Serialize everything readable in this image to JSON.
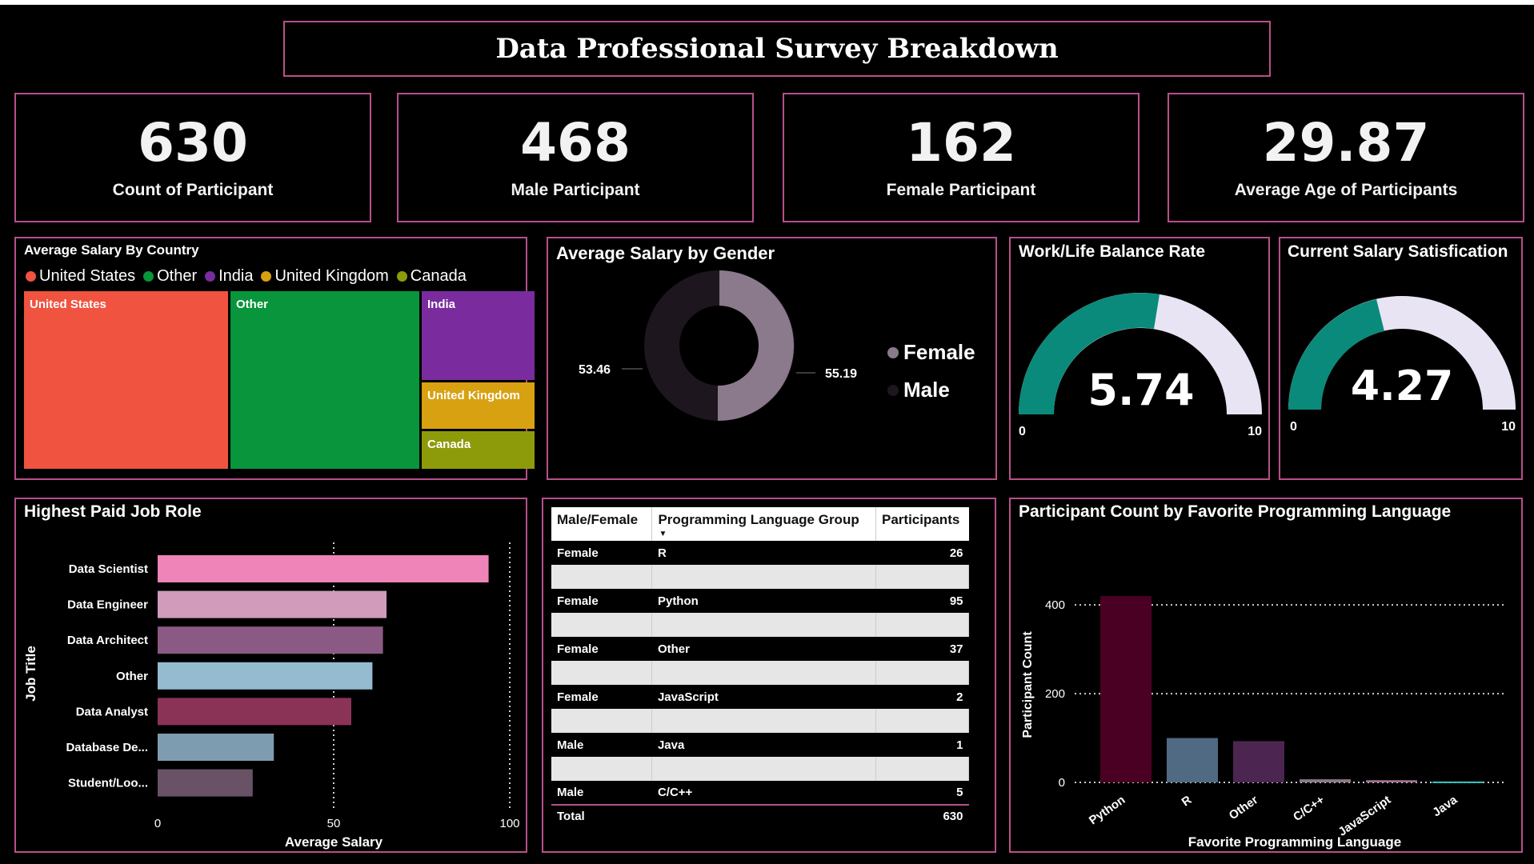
{
  "header": {
    "title": "Data Professional Survey Breakdown"
  },
  "kpis": [
    {
      "value": "630",
      "label": "Count of Participant"
    },
    {
      "value": "468",
      "label": "Male Participant"
    },
    {
      "value": "162",
      "label": "Female Participant"
    },
    {
      "value": "29.87",
      "label": "Average Age of Participants"
    }
  ],
  "treemap": {
    "title": "Average Salary By Country",
    "legend": [
      "United States",
      "Other",
      "India",
      "United Kingdom",
      "Canada"
    ],
    "colors": [
      "#f05340",
      "#08953b",
      "#7a2c9e",
      "#d8a111",
      "#8d9b0a"
    ],
    "tiles": [
      "United States",
      "Other",
      "India",
      "United Kingdom",
      "Canada"
    ]
  },
  "gender_donut": {
    "title": "Average Salary by Gender",
    "legend": [
      "Female",
      "Male"
    ],
    "colors": [
      "#8b7a8b",
      "#1e161e"
    ],
    "labels": [
      "53.46",
      "55.19"
    ]
  },
  "gauges": [
    {
      "title": "Work/Life Balance Rate",
      "value": "5.74",
      "min": "0",
      "max": "10"
    },
    {
      "title": "Current Salary Satisfication",
      "value": "4.27",
      "min": "0",
      "max": "10"
    }
  ],
  "chart_data": [
    {
      "type": "bar",
      "title": "Highest Paid Job Role",
      "xlabel": "Average Salary",
      "ylabel": "Job Title",
      "xlim": [
        0,
        100
      ],
      "ticks": [
        "0",
        "50",
        "100"
      ],
      "categories": [
        "Data Scientist",
        "Data Engineer",
        "Data Architect",
        "Other",
        "Data Analyst",
        "Database De...",
        "Student/Loo..."
      ],
      "values": [
        94,
        65,
        64,
        61,
        55,
        33,
        27
      ],
      "colors": [
        "#ee84b8",
        "#d19bbc",
        "#8a5a84",
        "#94bbd0",
        "#8b3356",
        "#7e9cb0",
        "#6a5266"
      ]
    },
    {
      "type": "bar",
      "title": "Participant Count by Favorite Programming Language",
      "xlabel": "Favorite Programming Language",
      "ylabel": "Participant Count",
      "ylim": [
        0,
        440
      ],
      "ticks": [
        "0",
        "200",
        "400"
      ],
      "grid": true,
      "categories": [
        "Python",
        "R",
        "Other",
        "C/C++",
        "JavaScript",
        "Java"
      ],
      "values": [
        420,
        100,
        93,
        7,
        5,
        2
      ],
      "colors": [
        "#4a0022",
        "#4f6a82",
        "#4c2550",
        "#8a7a88",
        "#a0708f",
        "#36c4c4"
      ]
    }
  ],
  "table": {
    "headers": [
      "Male/Female",
      "Programming Language Group",
      "Participants"
    ],
    "rows": [
      {
        "gender": "Female",
        "lang": "R",
        "count": "26"
      },
      {
        "gender": "Female",
        "lang": "Python",
        "count": "95"
      },
      {
        "gender": "Female",
        "lang": "Other",
        "count": "37"
      },
      {
        "gender": "Female",
        "lang": "JavaScript",
        "count": "2"
      },
      {
        "gender": "Male",
        "lang": "Java",
        "count": "1"
      },
      {
        "gender": "Male",
        "lang": "C/C++",
        "count": "5"
      }
    ],
    "total_label": "Total",
    "total_value": "630"
  }
}
